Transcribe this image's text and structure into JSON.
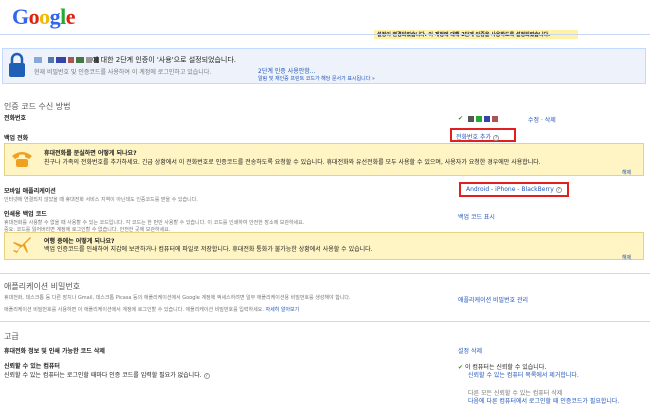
{
  "logo": {
    "text": "Google"
  },
  "notice": "설정이 변경되었습니다. 이 계정에 대해 2단계 인증을 사용하도록 설정되었습니다.",
  "banner": {
    "title": "에 대한 2단계 인증이 '사용'으로 설정되었습니다.",
    "subtitle": "현재 비밀번호 및 인증코드를 사용하여 이 계정에 로그인하고 있습니다.",
    "link_main": "2단계 인증 사용안함...",
    "link_sub": "알림 및 재인증 프린트 코드가 해당 문서가 표시됩니다 »"
  },
  "section_receive": {
    "heading": "인증 코드 수신 방법",
    "phone_label": "전화번호",
    "phone_actions": "수정 · 삭제",
    "backup_label": "백업 전화",
    "backup_add": "전화번호 추가",
    "backup_help_title": "휴대전화를 분실하면 어떻게 되나요?",
    "backup_help_body": "친구나 가족의 전화번호를 추가하세요. 긴급 상황에서 이 전화번호로 인증코드를 전송하도록 요청할 수 있습니다. 휴대전화와 유선전화를 모두 사용할 수 있으며, 사용자가 요청한 경우에만 사용합니다.",
    "close1": "해제",
    "mobile_label": "모바일 애플리케이션",
    "mobile_desc": "인터넷에 연결되지 않았을 때 휴대전화 서비스 지역이 아닌데도 인증코드를 받을 수 있습니다.",
    "mobile_link": "Android - iPhone - BlackBerry",
    "printable_label": "인쇄용 백업 코드",
    "printable_desc1": "휴대전화를 사용할 수 없을 때 사용할 수 있는 코드입니다. 각 코드는 한 번만 사용할 수 있습니다. 이 코드를 인쇄하여 안전한 장소에 보관하세요.",
    "printable_desc2": "중요: 코드를 잃어버리면 계정에 로그인할 수 없습니다. 안전한 곳에 보관하세요.",
    "printable_link": "백업 코드 표시",
    "travel_title": "여행 중에는 어떻게 되나요?",
    "travel_body": "백업 인증코드를 인쇄하여 지갑에 보관하거나 컴퓨터에 파일로 저장합니다. 휴대전화 통화가 불가능한 상황에서 사용할 수 있습니다.",
    "close2": "해제"
  },
  "section_app_pw": {
    "heading": "애플리케이션 비밀번호",
    "desc1": "휴대전화, 데스크톱 등 다른 장치나 Gmail, 데스크톱 Picasa 등의 애플리케이션에서 Google 계정에 액세스하려면 일부 애플리케이션용 비밀번호를 생성해야 합니다.",
    "desc2": "애플리케이션 비밀번호를 사용하면 이 애플리케이션에서 계정에 로그인할 수 있습니다. 애플리케이션 비밀번호를 입력하세요.",
    "desc_link": "자세히 알아보기",
    "link": "애플리케이션 비밀번호 관리"
  },
  "section_adv": {
    "heading": "고급",
    "sub": "휴대전화 정보 및 인쇄 가능한 코드 삭제",
    "sub_link": "설정 삭제",
    "trusted_label": "신뢰할 수 있는 컴퓨터",
    "trusted_desc": "신뢰할 수 있는 컴퓨터는 로그인할 때마다 인증 코드를 입력할 필요가 없습니다.",
    "trusted_status": "이 컴퓨터는 신뢰할 수 있습니다.",
    "trusted_remove": "신뢰할 수 있는 컴퓨터 목록에서 제거합니다.",
    "other_label": "다른 모든 신뢰할 수 있는 컴퓨터 삭제",
    "other_link": "다음에 다른 컴퓨터에서 로그인할 때 인증코드가 필요합니다."
  },
  "colors": {
    "accent": "#2255bb",
    "danger": "#e02020",
    "yellow": "#fff5c4",
    "green": "#2a9b2a"
  }
}
